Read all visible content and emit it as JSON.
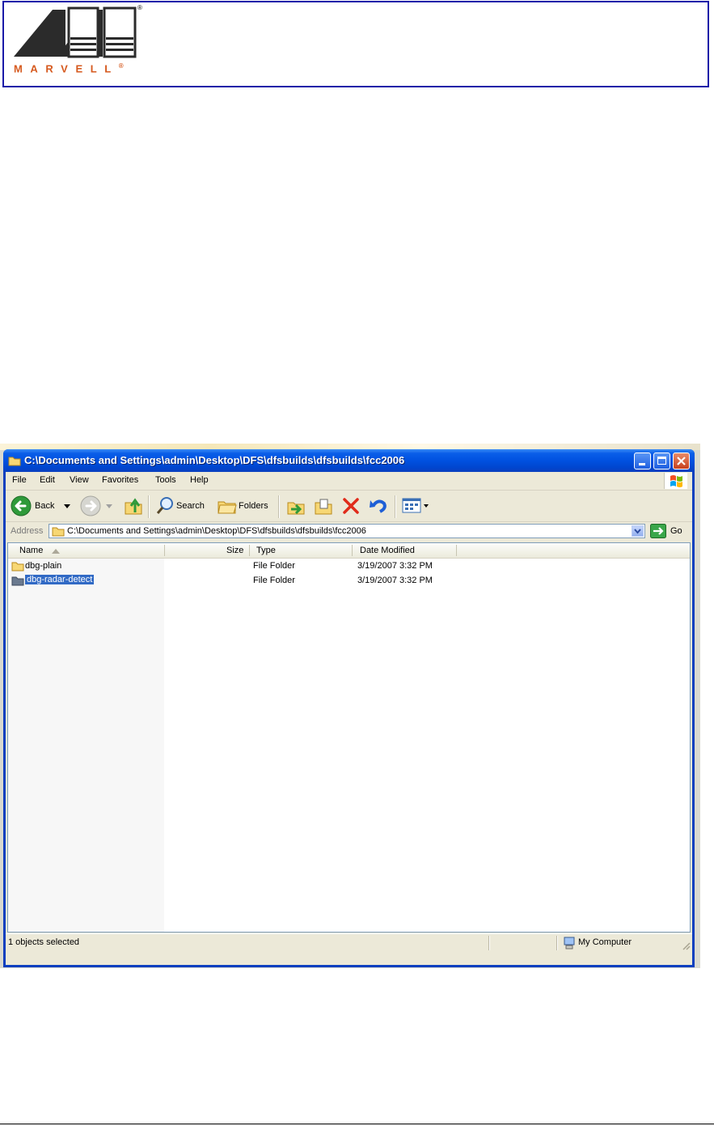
{
  "header": {
    "logo_word": "MARVELL",
    "registered": "®"
  },
  "window": {
    "title": "C:\\Documents and Settings\\admin\\Desktop\\DFS\\dfsbuilds\\dfsbuilds\\fcc2006",
    "menu": [
      "File",
      "Edit",
      "View",
      "Favorites",
      "Tools",
      "Help"
    ],
    "toolbar": {
      "back": "Back",
      "search": "Search",
      "folders": "Folders"
    },
    "address": {
      "label": "Address",
      "value": "C:\\Documents and Settings\\admin\\Desktop\\DFS\\dfsbuilds\\dfsbuilds\\fcc2006",
      "go": "Go"
    },
    "columns": {
      "name": "Name",
      "size": "Size",
      "type": "Type",
      "date": "Date Modified"
    },
    "rows": [
      {
        "name": "dbg-plain",
        "size": "",
        "type": "File Folder",
        "date": "3/19/2007 3:32 PM",
        "selected": false
      },
      {
        "name": "dbg-radar-detect",
        "size": "",
        "type": "File Folder",
        "date": "3/19/2007 3:32 PM",
        "selected": true
      }
    ],
    "status": {
      "left": "1 objects selected",
      "right": "My Computer"
    }
  },
  "colors": {
    "border_blue": "#1a1aa8",
    "brand_orange": "#d65a1f",
    "xp_title_blue": "#0051e0",
    "selection": "#316ac5"
  }
}
